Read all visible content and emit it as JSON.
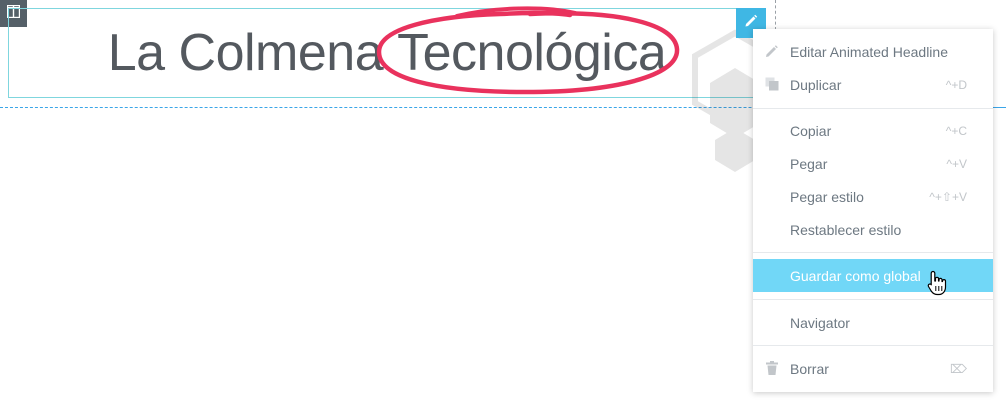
{
  "headline": {
    "before_text": "La Colmena",
    "highlighted_text": "Tecnológica",
    "circle_color": "#e9325d"
  },
  "context_menu": {
    "items": [
      {
        "label": "Editar Animated Headline",
        "shortcut": "",
        "icon": "pencil-icon"
      },
      {
        "label": "Duplicar",
        "shortcut": "^+D",
        "icon": "copy-icon"
      },
      {
        "label": "Copiar",
        "shortcut": "^+C",
        "icon": ""
      },
      {
        "label": "Pegar",
        "shortcut": "^+V",
        "icon": ""
      },
      {
        "label": "Pegar estilo",
        "shortcut": "^+⇧+V",
        "icon": ""
      },
      {
        "label": "Restablecer estilo",
        "shortcut": "",
        "icon": ""
      },
      {
        "label": "Guardar como global",
        "shortcut": "",
        "icon": "",
        "active": true
      },
      {
        "label": "Navigator",
        "shortcut": "",
        "icon": ""
      },
      {
        "label": "Borrar",
        "shortcut": "⌦",
        "icon": "trash-icon"
      }
    ],
    "active_color": "#71d7f7"
  },
  "toolbar": {
    "edit_icon": "pencil-icon",
    "section_icon": "columns-icon"
  }
}
